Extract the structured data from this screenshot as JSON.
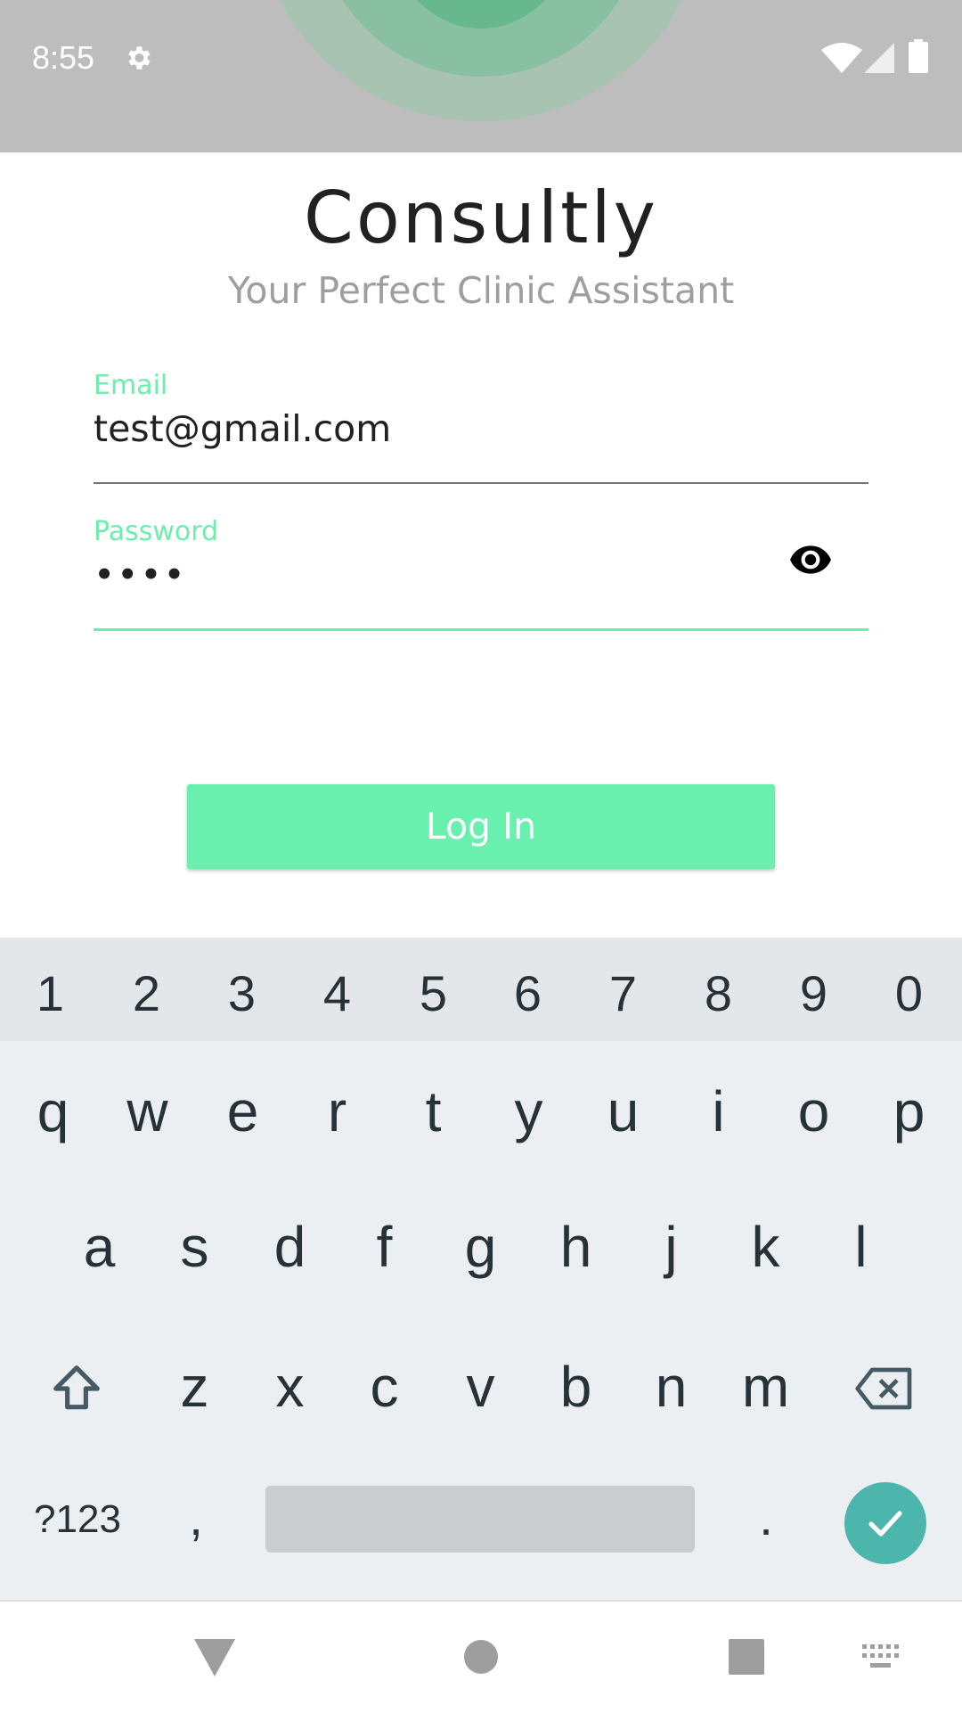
{
  "status_bar": {
    "time": "8:55",
    "icons": [
      "gear-icon",
      "wifi-icon",
      "cellular-signal-icon",
      "battery-icon"
    ]
  },
  "app": {
    "title": "Consultly",
    "subtitle": "Your Perfect Clinic Assistant"
  },
  "form": {
    "email_label": "Email",
    "email_value": "test@gmail.com",
    "password_label": "Password",
    "password_value": "••••",
    "login_label": "Log In"
  },
  "keyboard": {
    "number_row": [
      "1",
      "2",
      "3",
      "4",
      "5",
      "6",
      "7",
      "8",
      "9",
      "0"
    ],
    "row1": [
      "q",
      "w",
      "e",
      "r",
      "t",
      "y",
      "u",
      "i",
      "o",
      "p"
    ],
    "row2": [
      "a",
      "s",
      "d",
      "f",
      "g",
      "h",
      "j",
      "k",
      "l"
    ],
    "row3": [
      "z",
      "x",
      "c",
      "v",
      "b",
      "n",
      "m"
    ],
    "symbols_label": "?123",
    "comma": ",",
    "period": "."
  },
  "colors": {
    "accent": "#69f0ae",
    "label": "#6ceeac",
    "enter_key": "#4db6ac",
    "status_bar": "#bdbdbd"
  }
}
